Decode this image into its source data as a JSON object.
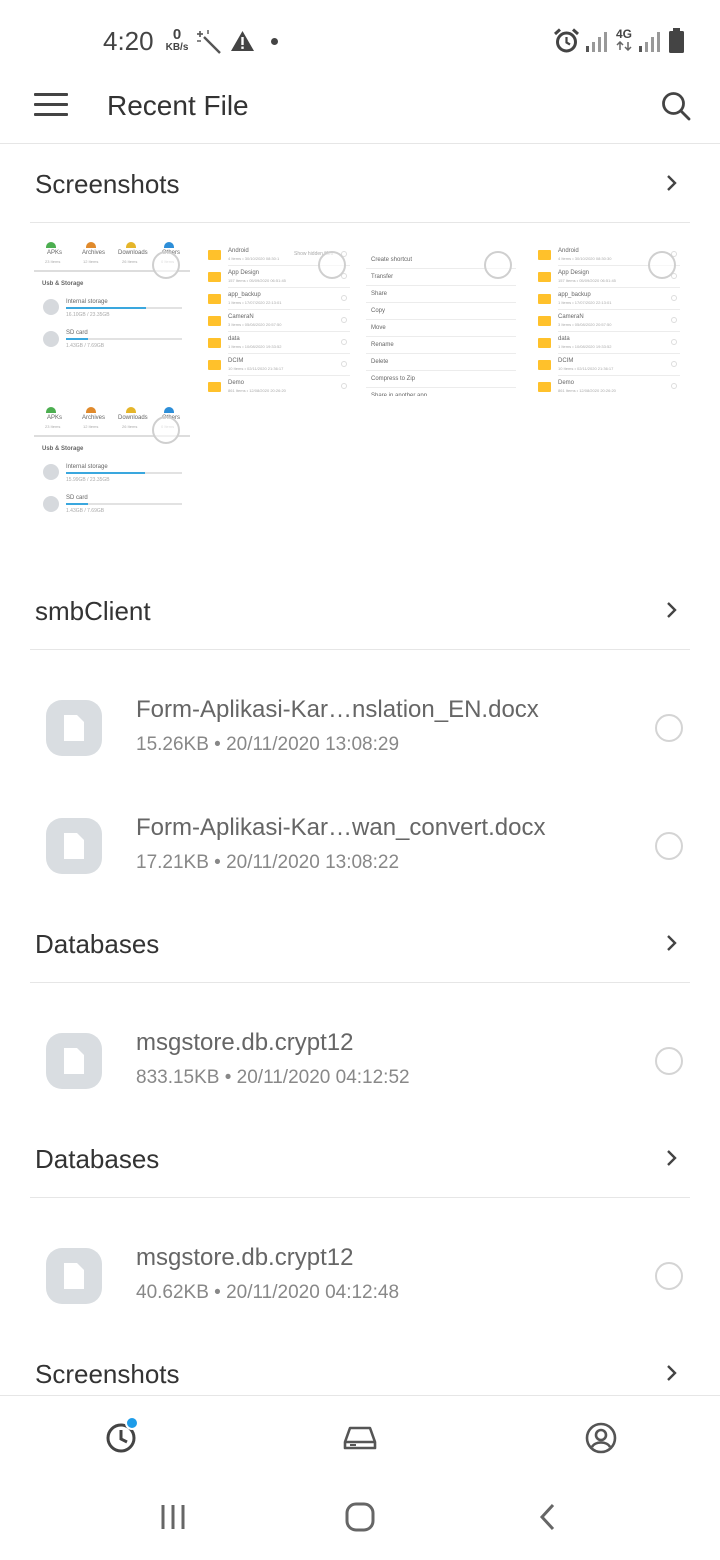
{
  "status_bar": {
    "time": "4:20",
    "net_speed_value": "0",
    "net_speed_unit": "KB/s",
    "network_type": "4G",
    "icons": [
      "wand-icon",
      "warning-icon",
      "dot-icon",
      "alarm-icon",
      "signal-icon",
      "network-4g-icon",
      "signal-icon",
      "battery-icon"
    ]
  },
  "app_bar": {
    "title": "Recent File",
    "menu_icon": "hamburger-menu-icon",
    "search_icon": "search-icon"
  },
  "sections": [
    {
      "title": "Screenshots",
      "thumbnails": [
        {
          "labels": [
            "APKs",
            "Archives",
            "Downloads",
            "Others"
          ],
          "counts": [
            "23 Items",
            "12 Items",
            "26 Items",
            "0 Items"
          ],
          "storage_title": "Usb & Storage",
          "internal_label": "Internal storage",
          "internal_value": "16.10GB / 23.35GB",
          "internal_fill": 0.69,
          "sd_label": "SD card",
          "sd_value": "1.43GB / 7.69GB",
          "sd_fill": 0.19
        },
        {
          "header_right": "Show hidden files",
          "items": [
            {
              "name": "Android",
              "meta": "4 Items • 30/10/2020 08:30:1"
            },
            {
              "name": "App Design",
              "meta": "157 Items • 05/09/2020 06:51:45"
            },
            {
              "name": "app_backup",
              "meta": "1 Items • 17/07/2020 22:13:01"
            },
            {
              "name": "CameraN",
              "meta": "3 Items • 05/08/2020 20:57:50"
            },
            {
              "name": "data",
              "meta": "1 Items • 10/08/2020 19:33:52"
            },
            {
              "name": "DCIM",
              "meta": "10 Items • 02/11/2020 21:36:17"
            },
            {
              "name": "Demo",
              "meta": "861 Items • 12/08/2020 20:26:20"
            }
          ]
        },
        {
          "menu_items": [
            "Create shortcut",
            "Transfer",
            "Share",
            "Copy",
            "Move",
            "Rename",
            "Delete",
            "Compress to Zip",
            "Share in another app"
          ]
        },
        {
          "items": [
            {
              "name": "Android",
              "meta": "4 Items • 30/10/2020 08:30:30"
            },
            {
              "name": "App Design",
              "meta": "157 Items • 05/09/2020 06:51:45"
            },
            {
              "name": "app_backup",
              "meta": "1 Items • 17/07/2020 22:13:01"
            },
            {
              "name": "CameraN",
              "meta": "3 Items • 05/08/2020 20:57:50"
            },
            {
              "name": "data",
              "meta": "1 Items • 10/08/2020 19:33:52"
            },
            {
              "name": "DCIM",
              "meta": "10 Items • 02/11/2020 21:36:17"
            },
            {
              "name": "Demo",
              "meta": "861 Items • 12/08/2020 20:26:20"
            }
          ]
        },
        {
          "labels": [
            "APKs",
            "Archives",
            "Downloads",
            "Others"
          ],
          "counts": [
            "23 Items",
            "12 Items",
            "26 Items",
            "0 Items"
          ],
          "storage_title": "Usb & Storage",
          "internal_label": "Internal storage",
          "internal_value": "15.99GB / 23.35GB",
          "internal_fill": 0.68,
          "sd_label": "SD card",
          "sd_value": "1.43GB / 7.69GB",
          "sd_fill": 0.19
        }
      ]
    },
    {
      "title": "smbClient",
      "files": [
        {
          "name": "Form-Aplikasi-Kar…nslation_EN.docx",
          "meta": "15.26KB • 20/11/2020 13:08:29"
        },
        {
          "name": "Form-Aplikasi-Kar…wan_convert.docx",
          "meta": "17.21KB • 20/11/2020 13:08:22"
        }
      ]
    },
    {
      "title": "Databases",
      "files": [
        {
          "name": "msgstore.db.crypt12",
          "meta": "833.15KB • 20/11/2020 04:12:52"
        }
      ]
    },
    {
      "title": "Databases",
      "files": [
        {
          "name": "msgstore.db.crypt12",
          "meta": "40.62KB • 20/11/2020 04:12:48"
        }
      ]
    },
    {
      "title": "Screenshots",
      "files": []
    }
  ],
  "bottom_nav": {
    "items": [
      {
        "icon": "recent-clock-icon",
        "active": true,
        "has_badge": true
      },
      {
        "icon": "storage-drive-icon",
        "active": false
      },
      {
        "icon": "account-icon",
        "active": false
      }
    ]
  },
  "system_nav": {
    "icons": [
      "recent-apps-icon",
      "home-icon",
      "back-icon"
    ]
  },
  "colors": {
    "accent": "#1e9ce8",
    "folder": "#ffc12b",
    "divider": "#e6e6e6",
    "file_tile": "#d9dde1"
  }
}
